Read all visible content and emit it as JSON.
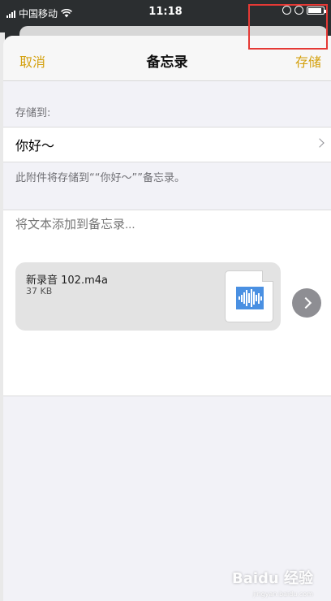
{
  "status_bar": {
    "carrier": "中国移动",
    "time": "11:18"
  },
  "navbar": {
    "cancel_label": "取消",
    "title": "备忘录",
    "save_label": "存储",
    "accent_color": "#d4a10f"
  },
  "destination": {
    "section_label": "存储到:",
    "note_title": "你好～",
    "footnote": "此附件将存储到““你好～””备忘录。"
  },
  "compose": {
    "placeholder": "将文本添加到备忘录..."
  },
  "attachment": {
    "file_name": "新录音 102.m4a",
    "file_size": "37 KB",
    "icon": "audio-file-icon"
  },
  "watermark": {
    "brand": "Baidu 经验",
    "url": "jingyan.baidu.com"
  }
}
